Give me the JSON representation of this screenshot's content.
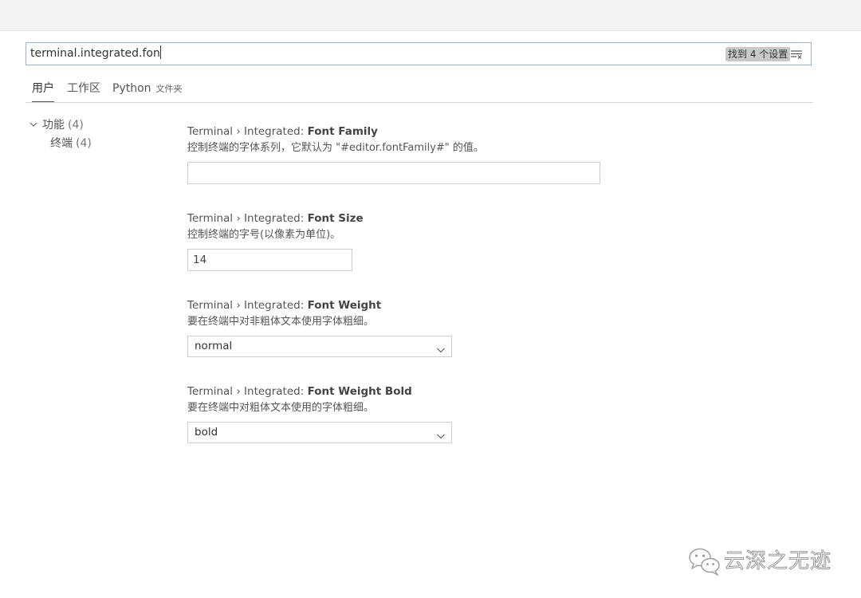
{
  "search": {
    "value": "terminal.integrated.fon",
    "result_badge": "找到 4 个设置",
    "clear_icon": "clear-filter-icon"
  },
  "tabs": [
    {
      "label": "用户",
      "active": true
    },
    {
      "label": "工作区",
      "active": false
    },
    {
      "label": "Python",
      "sub": "文件夹",
      "active": false
    }
  ],
  "toc": {
    "group": {
      "label": "功能",
      "count": "(4)",
      "expanded": true
    },
    "child": {
      "label": "终端",
      "count": "(4)"
    }
  },
  "settings": [
    {
      "prefix": "Terminal › Integrated: ",
      "name": "Font Family",
      "description": "控制终端的字体系列，它默认为 \"#editor.fontFamily#\" 的值。",
      "value": ""
    },
    {
      "prefix": "Terminal › Integrated: ",
      "name": "Font Size",
      "description": "控制终端的字号(以像素为单位)。",
      "value": "14"
    },
    {
      "prefix": "Terminal › Integrated: ",
      "name": "Font Weight",
      "description": "要在终端中对非粗体文本使用字体粗细。",
      "value": "normal"
    },
    {
      "prefix": "Terminal › Integrated: ",
      "name": "Font Weight Bold",
      "description": "要在终端中对粗体文本使用的字体粗细。",
      "value": "bold"
    }
  ],
  "watermark": {
    "text": "云深之无迹",
    "icon": "wechat-logo-icon"
  },
  "colors": {
    "search_border": "#90b4e0",
    "badge_bg": "#c8c8c8",
    "topbar_bg": "#f3f3f3"
  }
}
